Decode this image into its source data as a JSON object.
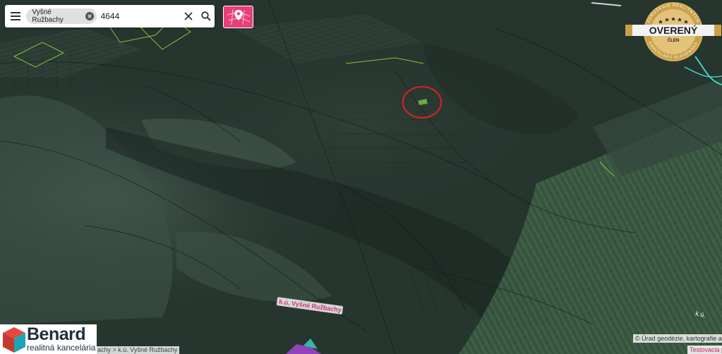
{
  "search": {
    "chip_label": "Vyšné Ružbachy",
    "query_value": "4644",
    "query_placeholder": ""
  },
  "map": {
    "parcel_label": "k.ú. Vyšné Ružbachy",
    "secondary_label": "k.ú."
  },
  "badge": {
    "top_text": "ZDRUŽENIE REALITNÝCH",
    "bottom_text": "KANCELÁRIÍ SLOVENSKA",
    "title": "OVERENÝ",
    "subtitle": "ČLEN"
  },
  "logo": {
    "title": "Benard",
    "subtitle": "realitná kancelária"
  },
  "footer": {
    "breadcrumb": "achy > k.ú. Vyšné Ružbachy",
    "attribution": "© Úrad geodézie, kartografie a k",
    "testing_link": "Testovacia p"
  },
  "colors": {
    "accent": "#e83e7a",
    "marker_circle": "#e02020",
    "badge_gold": "#d9b25a",
    "logo_navy": "#1f2f3f",
    "logo_red": "#e04a3f",
    "logo_teal": "#1aa6b7"
  },
  "icons": {
    "menu": "menu-icon",
    "chip_close": "close-circle-icon",
    "clear": "close-icon",
    "search": "search-icon",
    "pin": "location-pin-icon"
  }
}
